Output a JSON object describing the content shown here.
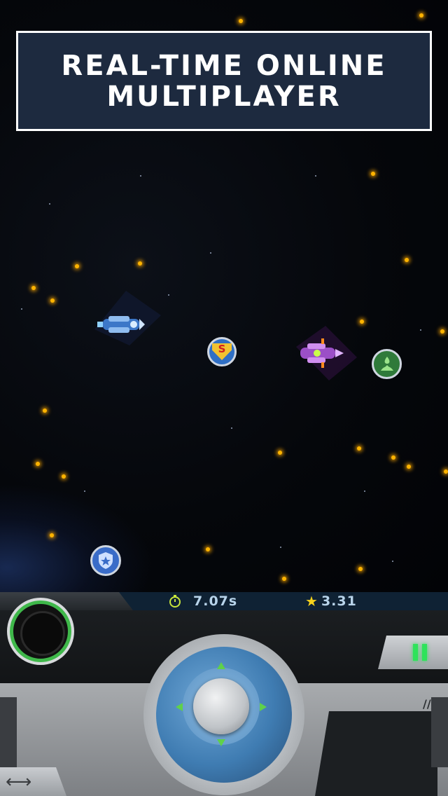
{
  "banner": {
    "line1": "REAL-TIME ONLINE",
    "line2": "MULTIPLAYER"
  },
  "hud": {
    "timer_value": "7.07s",
    "star_value": "3.31",
    "accent_color": "#3fb84a",
    "pause_color": "#2ee35a"
  },
  "icons": {
    "timer": "stopwatch-icon",
    "star": "star-icon",
    "pause": "pause-icon",
    "swap": "swap-arrows-icon",
    "powerup_s": "super-powerup-icon",
    "powerup_flame": "flame-powerup-icon",
    "powerup_shield": "shield-powerup-icon"
  },
  "powerups": {
    "s_label": "S"
  }
}
